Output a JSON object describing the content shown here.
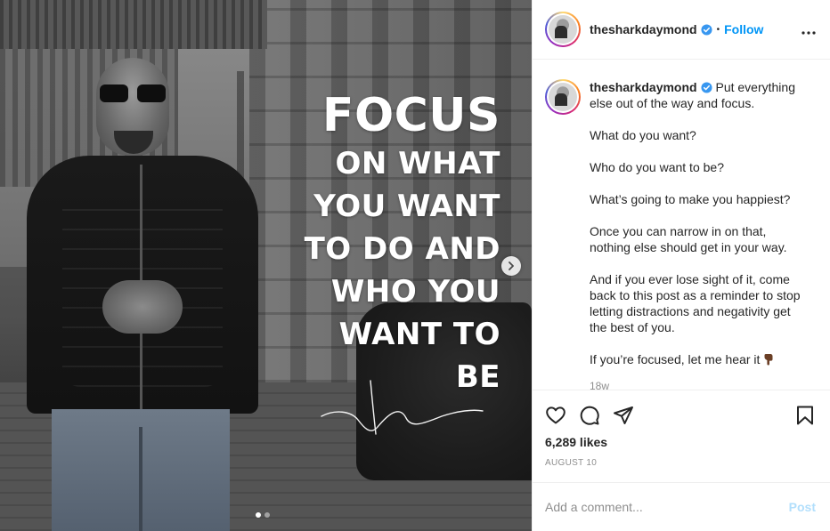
{
  "post": {
    "image": {
      "headline_big": "FOCUS",
      "headline_lines": [
        "ON WHAT",
        "YOU WANT",
        "TO DO AND",
        "WHO YOU",
        "WANT TO BE"
      ],
      "carousel": {
        "current": 1,
        "total": 2
      }
    },
    "header": {
      "username": "thesharkdaymond",
      "separator": "•",
      "follow_label": "Follow",
      "more_icon": "more-dots-icon"
    },
    "caption": {
      "username": "thesharkdaymond",
      "paragraphs": [
        "Put everything else out of the way and focus.",
        "What do you want?",
        "Who do you want to be?",
        "What’s going to make you happiest?",
        "Once you can narrow in on that, nothing else should get in your way.",
        "And if you ever lose sight of it, come back to this post as a reminder to stop letting distractions and negativity get the best of you.",
        "If you’re focused, let me hear it"
      ],
      "emoji": "pointing-down-hand-emoji",
      "age": "18w"
    },
    "actions": {
      "like_icon": "heart-icon",
      "comment_icon": "comment-bubble-icon",
      "share_icon": "paper-plane-icon",
      "save_icon": "bookmark-icon"
    },
    "likes": "6,289 likes",
    "date": "AUGUST 10",
    "comment_box": {
      "placeholder": "Add a comment...",
      "post_label": "Post"
    }
  },
  "colors": {
    "accent": "#0095f6",
    "post_disabled": "#b2dffc",
    "text": "#262626",
    "muted": "#8e8e8e",
    "divider": "#efefef"
  }
}
